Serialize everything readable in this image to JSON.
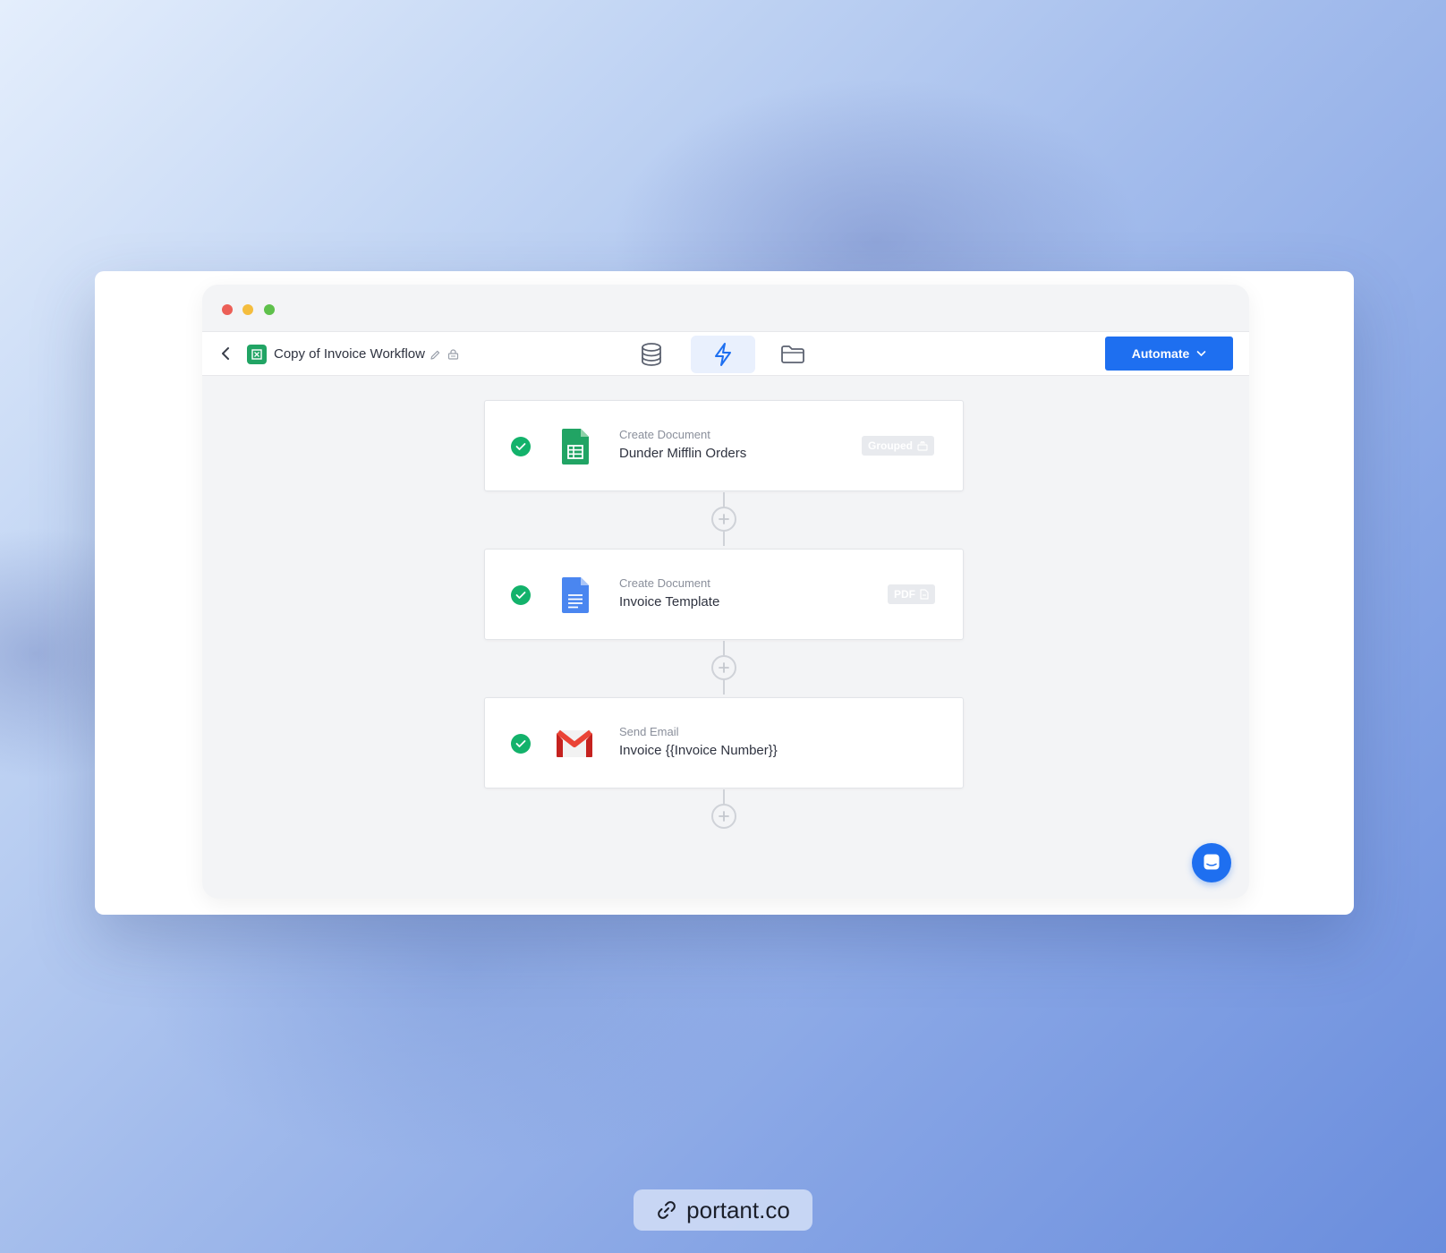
{
  "window": {
    "title": "Copy of Invoice Workflow"
  },
  "toolbar": {
    "tabs": [
      {
        "icon": "database-icon",
        "active": false
      },
      {
        "icon": "lightning-icon",
        "active": true
      },
      {
        "icon": "folder-icon",
        "active": false
      }
    ],
    "automate_label": "Automate"
  },
  "steps": [
    {
      "type": "Create Document",
      "name": "Dunder Mifflin Orders",
      "app": "google-sheets-icon",
      "tag": "Grouped",
      "tag_icon": "stack-icon",
      "status": "complete"
    },
    {
      "type": "Create Document",
      "name": "Invoice Template",
      "app": "google-docs-icon",
      "tag": "PDF",
      "tag_icon": "file-icon",
      "status": "complete"
    },
    {
      "type": "Send Email",
      "name": "Invoice {{Invoice Number}}",
      "app": "gmail-icon",
      "tag": "",
      "status": "complete"
    }
  ],
  "footer": {
    "link_text": "portant.co"
  },
  "colors": {
    "accent": "#1e6ff0",
    "success": "#13b26b",
    "sheets_green": "#21a464",
    "docs_blue": "#4a86f0",
    "gmail_red": "#ea4335"
  }
}
